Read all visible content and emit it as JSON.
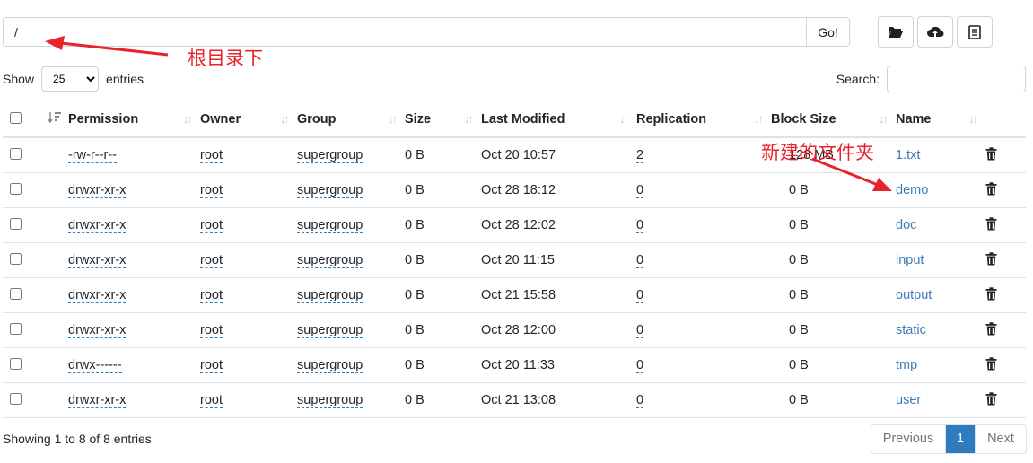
{
  "path_bar": {
    "value": "/",
    "go_label": "Go!"
  },
  "toolbar": {
    "icons": [
      "folder-open-icon",
      "cloud-upload-icon",
      "clipboard-icon"
    ]
  },
  "length_control": {
    "show_label": "Show",
    "selected": "25",
    "entries_label": "entries"
  },
  "search": {
    "label": "Search:",
    "value": ""
  },
  "table": {
    "columns": [
      "Permission",
      "Owner",
      "Group",
      "Size",
      "Last Modified",
      "Replication",
      "Block Size",
      "Name"
    ],
    "rows": [
      {
        "permission": "-rw-r--r--",
        "owner": "root",
        "group": "supergroup",
        "size": "0 B",
        "modified": "Oct 20 10:57",
        "replication": "2",
        "block_size": "128 MB",
        "name": "1.txt"
      },
      {
        "permission": "drwxr-xr-x",
        "owner": "root",
        "group": "supergroup",
        "size": "0 B",
        "modified": "Oct 28 18:12",
        "replication": "0",
        "block_size": "0 B",
        "name": "demo"
      },
      {
        "permission": "drwxr-xr-x",
        "owner": "root",
        "group": "supergroup",
        "size": "0 B",
        "modified": "Oct 28 12:02",
        "replication": "0",
        "block_size": "0 B",
        "name": "doc"
      },
      {
        "permission": "drwxr-xr-x",
        "owner": "root",
        "group": "supergroup",
        "size": "0 B",
        "modified": "Oct 20 11:15",
        "replication": "0",
        "block_size": "0 B",
        "name": "input"
      },
      {
        "permission": "drwxr-xr-x",
        "owner": "root",
        "group": "supergroup",
        "size": "0 B",
        "modified": "Oct 21 15:58",
        "replication": "0",
        "block_size": "0 B",
        "name": "output"
      },
      {
        "permission": "drwxr-xr-x",
        "owner": "root",
        "group": "supergroup",
        "size": "0 B",
        "modified": "Oct 28 12:00",
        "replication": "0",
        "block_size": "0 B",
        "name": "static"
      },
      {
        "permission": "drwx------",
        "owner": "root",
        "group": "supergroup",
        "size": "0 B",
        "modified": "Oct 20 11:33",
        "replication": "0",
        "block_size": "0 B",
        "name": "tmp"
      },
      {
        "permission": "drwxr-xr-x",
        "owner": "root",
        "group": "supergroup",
        "size": "0 B",
        "modified": "Oct 21 13:08",
        "replication": "0",
        "block_size": "0 B",
        "name": "user"
      }
    ]
  },
  "footer": {
    "info": "Showing 1 to 8 of 8 entries"
  },
  "pagination": {
    "previous": "Previous",
    "current": "1",
    "next": "Next"
  },
  "annotations": {
    "root_dir": "根目录下",
    "new_folder": "新建的文件夹",
    "color": "#e8232a"
  },
  "colors": {
    "link": "#3d7ab8",
    "active_page": "#2e7bbf"
  }
}
